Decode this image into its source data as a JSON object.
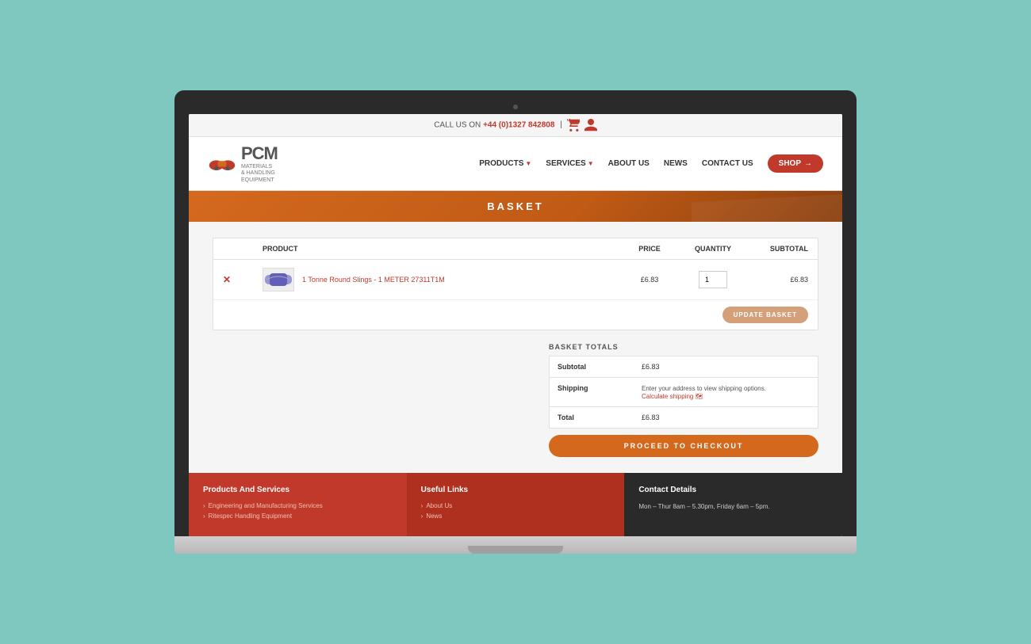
{
  "topbar": {
    "call_text": "CALL US ON",
    "phone": "+44 (0)1327 842808"
  },
  "header": {
    "logo_text": "PCM",
    "logo_subtitle": "MATERIALS\n& HANDLING\nEQUIPMENT",
    "nav": [
      {
        "label": "PRODUCTS",
        "has_dropdown": true
      },
      {
        "label": "SERVICES",
        "has_dropdown": true
      },
      {
        "label": "ABOUT US",
        "has_dropdown": false
      },
      {
        "label": "NEWS",
        "has_dropdown": false
      },
      {
        "label": "CONTACT US",
        "has_dropdown": false
      }
    ],
    "shop_button": "SHOP"
  },
  "banner": {
    "title": "BASKET"
  },
  "basket": {
    "columns": {
      "product": "Product",
      "price": "Price",
      "quantity": "Quantity",
      "subtotal": "Subtotal"
    },
    "items": [
      {
        "name": "1 Tonne Round Slings - 1 METER 27311T1M",
        "price": "£6.83",
        "qty": "1",
        "subtotal": "£6.83"
      }
    ],
    "update_button": "UPDATE BASKET"
  },
  "totals": {
    "section_title": "BASKET TOTALS",
    "subtotal_label": "Subtotal",
    "subtotal_value": "£6.83",
    "shipping_label": "Shipping",
    "shipping_note": "Enter your address to view shipping options.",
    "calculate_link": "Calculate shipping",
    "total_label": "Total",
    "total_value": "£6.83",
    "checkout_button": "PROCEED TO CHECKOUT"
  },
  "footer": {
    "col1": {
      "title": "Products And Services",
      "links": [
        "Engineering and Manufacturing Services",
        "Ritespec Handling Equipment"
      ]
    },
    "col2": {
      "title": "Useful Links",
      "links": [
        "About Us",
        "News"
      ]
    },
    "col3": {
      "title": "Contact Details",
      "hours": "Mon – Thur 8am – 5.30pm, Friday 6am – 5pm."
    }
  }
}
